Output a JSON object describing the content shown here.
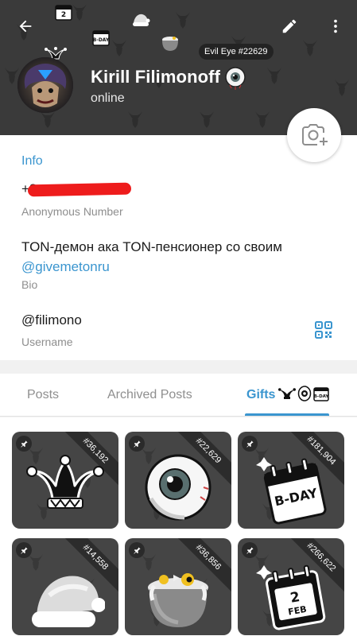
{
  "header": {
    "name": "Kirill Filimonoff",
    "status": "online",
    "tooltip": "Evil Eye #22629"
  },
  "info": {
    "title": "Info",
    "phone": "+8",
    "phone_label": "Anonymous Number",
    "bio_text": "TON-демон ака TON-пенсионер со своим",
    "bio_link": "@givemetonru",
    "bio_label": "Bio",
    "username": "@filimono",
    "username_label": "Username"
  },
  "tabs": {
    "posts": "Posts",
    "archived": "Archived Posts",
    "gifts": "Gifts"
  },
  "gifts": [
    {
      "number": "#36,192",
      "icon": "jester-hat-icon"
    },
    {
      "number": "#22,629",
      "icon": "evil-eye-icon"
    },
    {
      "number": "#181,904",
      "icon": "bday-calendar-icon"
    },
    {
      "number": "#14,558",
      "icon": "santa-hat-icon"
    },
    {
      "number": "#36,856",
      "icon": "witch-cauldron-icon"
    },
    {
      "number": "#266,622",
      "icon": "feb-calendar-icon"
    }
  ],
  "colors": {
    "accent": "#3a95cf",
    "header_bg": "#3a3a3a",
    "card_bg": "#454545",
    "redaction": "#ee1c1c"
  }
}
